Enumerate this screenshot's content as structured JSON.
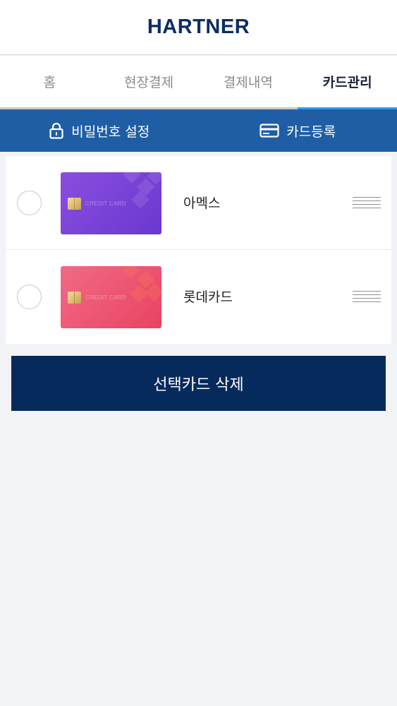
{
  "app": {
    "logo_text": "HARTNER"
  },
  "tabs": [
    {
      "label": "홈",
      "active": false
    },
    {
      "label": "현장결제",
      "active": false
    },
    {
      "label": "결제내역",
      "active": false
    },
    {
      "label": "카드관리",
      "active": true
    }
  ],
  "subbar": {
    "password_label": "비밀번호 설정",
    "password_icon": "lock-icon",
    "register_label": "카드등록",
    "register_icon": "credit-card-icon"
  },
  "cards": [
    {
      "name": "아멕스",
      "card_text": "CREDIT CARD",
      "color": "#7a42d8",
      "selected": false
    },
    {
      "name": "롯데카드",
      "card_text": "CREDIT CARD",
      "color": "#ec5470",
      "selected": false
    }
  ],
  "actions": {
    "delete_label": "선택카드 삭제"
  },
  "colors": {
    "brand": "#0c2d63",
    "subbar": "#1f5ea5",
    "active_tab_indicator": "#2e9be8",
    "delete_button": "#062a5c",
    "background": "#f2f3f6"
  }
}
